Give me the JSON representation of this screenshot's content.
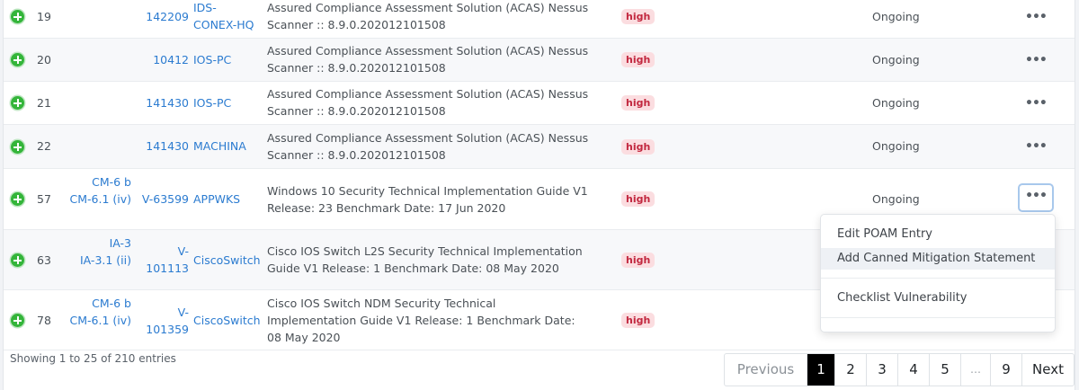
{
  "rows": [
    {
      "num": "19",
      "cci": [],
      "rule": [
        "142209"
      ],
      "host": [
        "IDS-",
        "CONEX-HQ"
      ],
      "source": [
        "Assured Compliance Assessment Solution (ACAS) Nessus",
        "Scanner :: 8.9.0.202012101508"
      ],
      "severity": "high",
      "status": "Ongoing"
    },
    {
      "num": "20",
      "cci": [],
      "rule": [
        "10412"
      ],
      "host": [
        "IOS-PC"
      ],
      "source": [
        "Assured Compliance Assessment Solution (ACAS) Nessus",
        "Scanner :: 8.9.0.202012101508"
      ],
      "severity": "high",
      "status": "Ongoing"
    },
    {
      "num": "21",
      "cci": [],
      "rule": [
        "141430"
      ],
      "host": [
        "IOS-PC"
      ],
      "source": [
        "Assured Compliance Assessment Solution (ACAS) Nessus",
        "Scanner :: 8.9.0.202012101508"
      ],
      "severity": "high",
      "status": "Ongoing"
    },
    {
      "num": "22",
      "cci": [],
      "rule": [
        "141430"
      ],
      "host": [
        "MACHINA"
      ],
      "source": [
        "Assured Compliance Assessment Solution (ACAS) Nessus",
        "Scanner :: 8.9.0.202012101508"
      ],
      "severity": "high",
      "status": "Ongoing"
    },
    {
      "num": "57",
      "cci": [
        "CM-6 b",
        "CM-6.1 (iv)"
      ],
      "rule": [
        "V-63599"
      ],
      "host": [
        "APPWKS"
      ],
      "source": [
        "Windows 10 Security Technical Implementation Guide V1",
        "Release: 23 Benchmark Date: 17 Jun 2020"
      ],
      "severity": "high",
      "status": "Ongoing"
    },
    {
      "num": "63",
      "cci": [
        "IA-3",
        "IA-3.1 (ii)"
      ],
      "rule": [
        "V-",
        "101113"
      ],
      "host": [
        "CiscoSwitch"
      ],
      "source": [
        "Cisco IOS Switch L2S Security Technical Implementation",
        "Guide V1 Release: 1 Benchmark Date: 08 May 2020"
      ],
      "severity": "high",
      "status": ""
    },
    {
      "num": "78",
      "cci": [
        "CM-6 b",
        "CM-6.1 (iv)"
      ],
      "rule": [
        "V-",
        "101359"
      ],
      "host": [
        "CiscoSwitch"
      ],
      "source": [
        "Cisco IOS Switch NDM Security Technical",
        "Implementation Guide V1 Release: 1 Benchmark Date:",
        "08 May 2020"
      ],
      "severity": "high",
      "status": ""
    }
  ],
  "menu": {
    "items": [
      "Edit POAM Entry",
      "Add Canned Mitigation Statement",
      "Checklist Vulnerability"
    ]
  },
  "footer": {
    "info": "Showing 1 to 25 of 210 entries"
  },
  "pagination": {
    "previous": "Previous",
    "pages": [
      "1",
      "2",
      "3",
      "4",
      "5",
      "…",
      "9"
    ],
    "next": "Next",
    "active_page": "1"
  },
  "more_glyph": "•••"
}
